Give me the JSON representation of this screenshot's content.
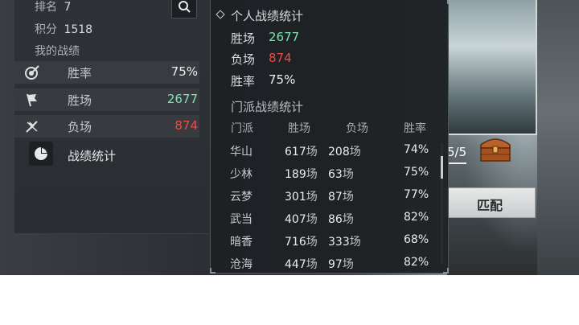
{
  "player": {
    "rank_label": "排名",
    "rank_value": "7",
    "points_label": "积分",
    "points_value": "1518",
    "my_record_label": "我的战绩"
  },
  "my_stats": [
    {
      "label": "胜率",
      "value": "75%",
      "icon": "target-icon",
      "color": "#eeeeee"
    },
    {
      "label": "胜场",
      "value": "2677",
      "icon": "flag-icon",
      "color": "#7de3b0"
    },
    {
      "label": "负场",
      "value": "874",
      "icon": "broken-flag-icon",
      "color": "#ef4b44"
    }
  ],
  "summary_button": {
    "label": "战绩统计",
    "icon": "pie-chart-icon"
  },
  "popup": {
    "personal_title": "个人战绩统计",
    "personal": [
      {
        "label": "胜场",
        "value": "2677",
        "color": "#7de3b0"
      },
      {
        "label": "负场",
        "value": "874",
        "color": "#ef4b44"
      },
      {
        "label": "胜率",
        "value": "75%",
        "color": "#eeeeee"
      }
    ],
    "faction_title": "门派战绩统计",
    "columns": [
      "门派",
      "胜场",
      "负场",
      "胜率"
    ],
    "unit": "场",
    "rows": [
      {
        "faction": "华山",
        "wins": "617",
        "losses": "208",
        "rate": "74%"
      },
      {
        "faction": "少林",
        "wins": "189",
        "losses": "63",
        "rate": "75%"
      },
      {
        "faction": "云梦",
        "wins": "301",
        "losses": "87",
        "rate": "77%"
      },
      {
        "faction": "武当",
        "wins": "407",
        "losses": "86",
        "rate": "82%"
      },
      {
        "faction": "暗香",
        "wins": "716",
        "losses": "333",
        "rate": "68%"
      },
      {
        "faction": "沧海",
        "wins": "447",
        "losses": "97",
        "rate": "82%"
      }
    ]
  },
  "right_panel": {
    "progress_text": "5/5",
    "match_button": "匹配"
  }
}
